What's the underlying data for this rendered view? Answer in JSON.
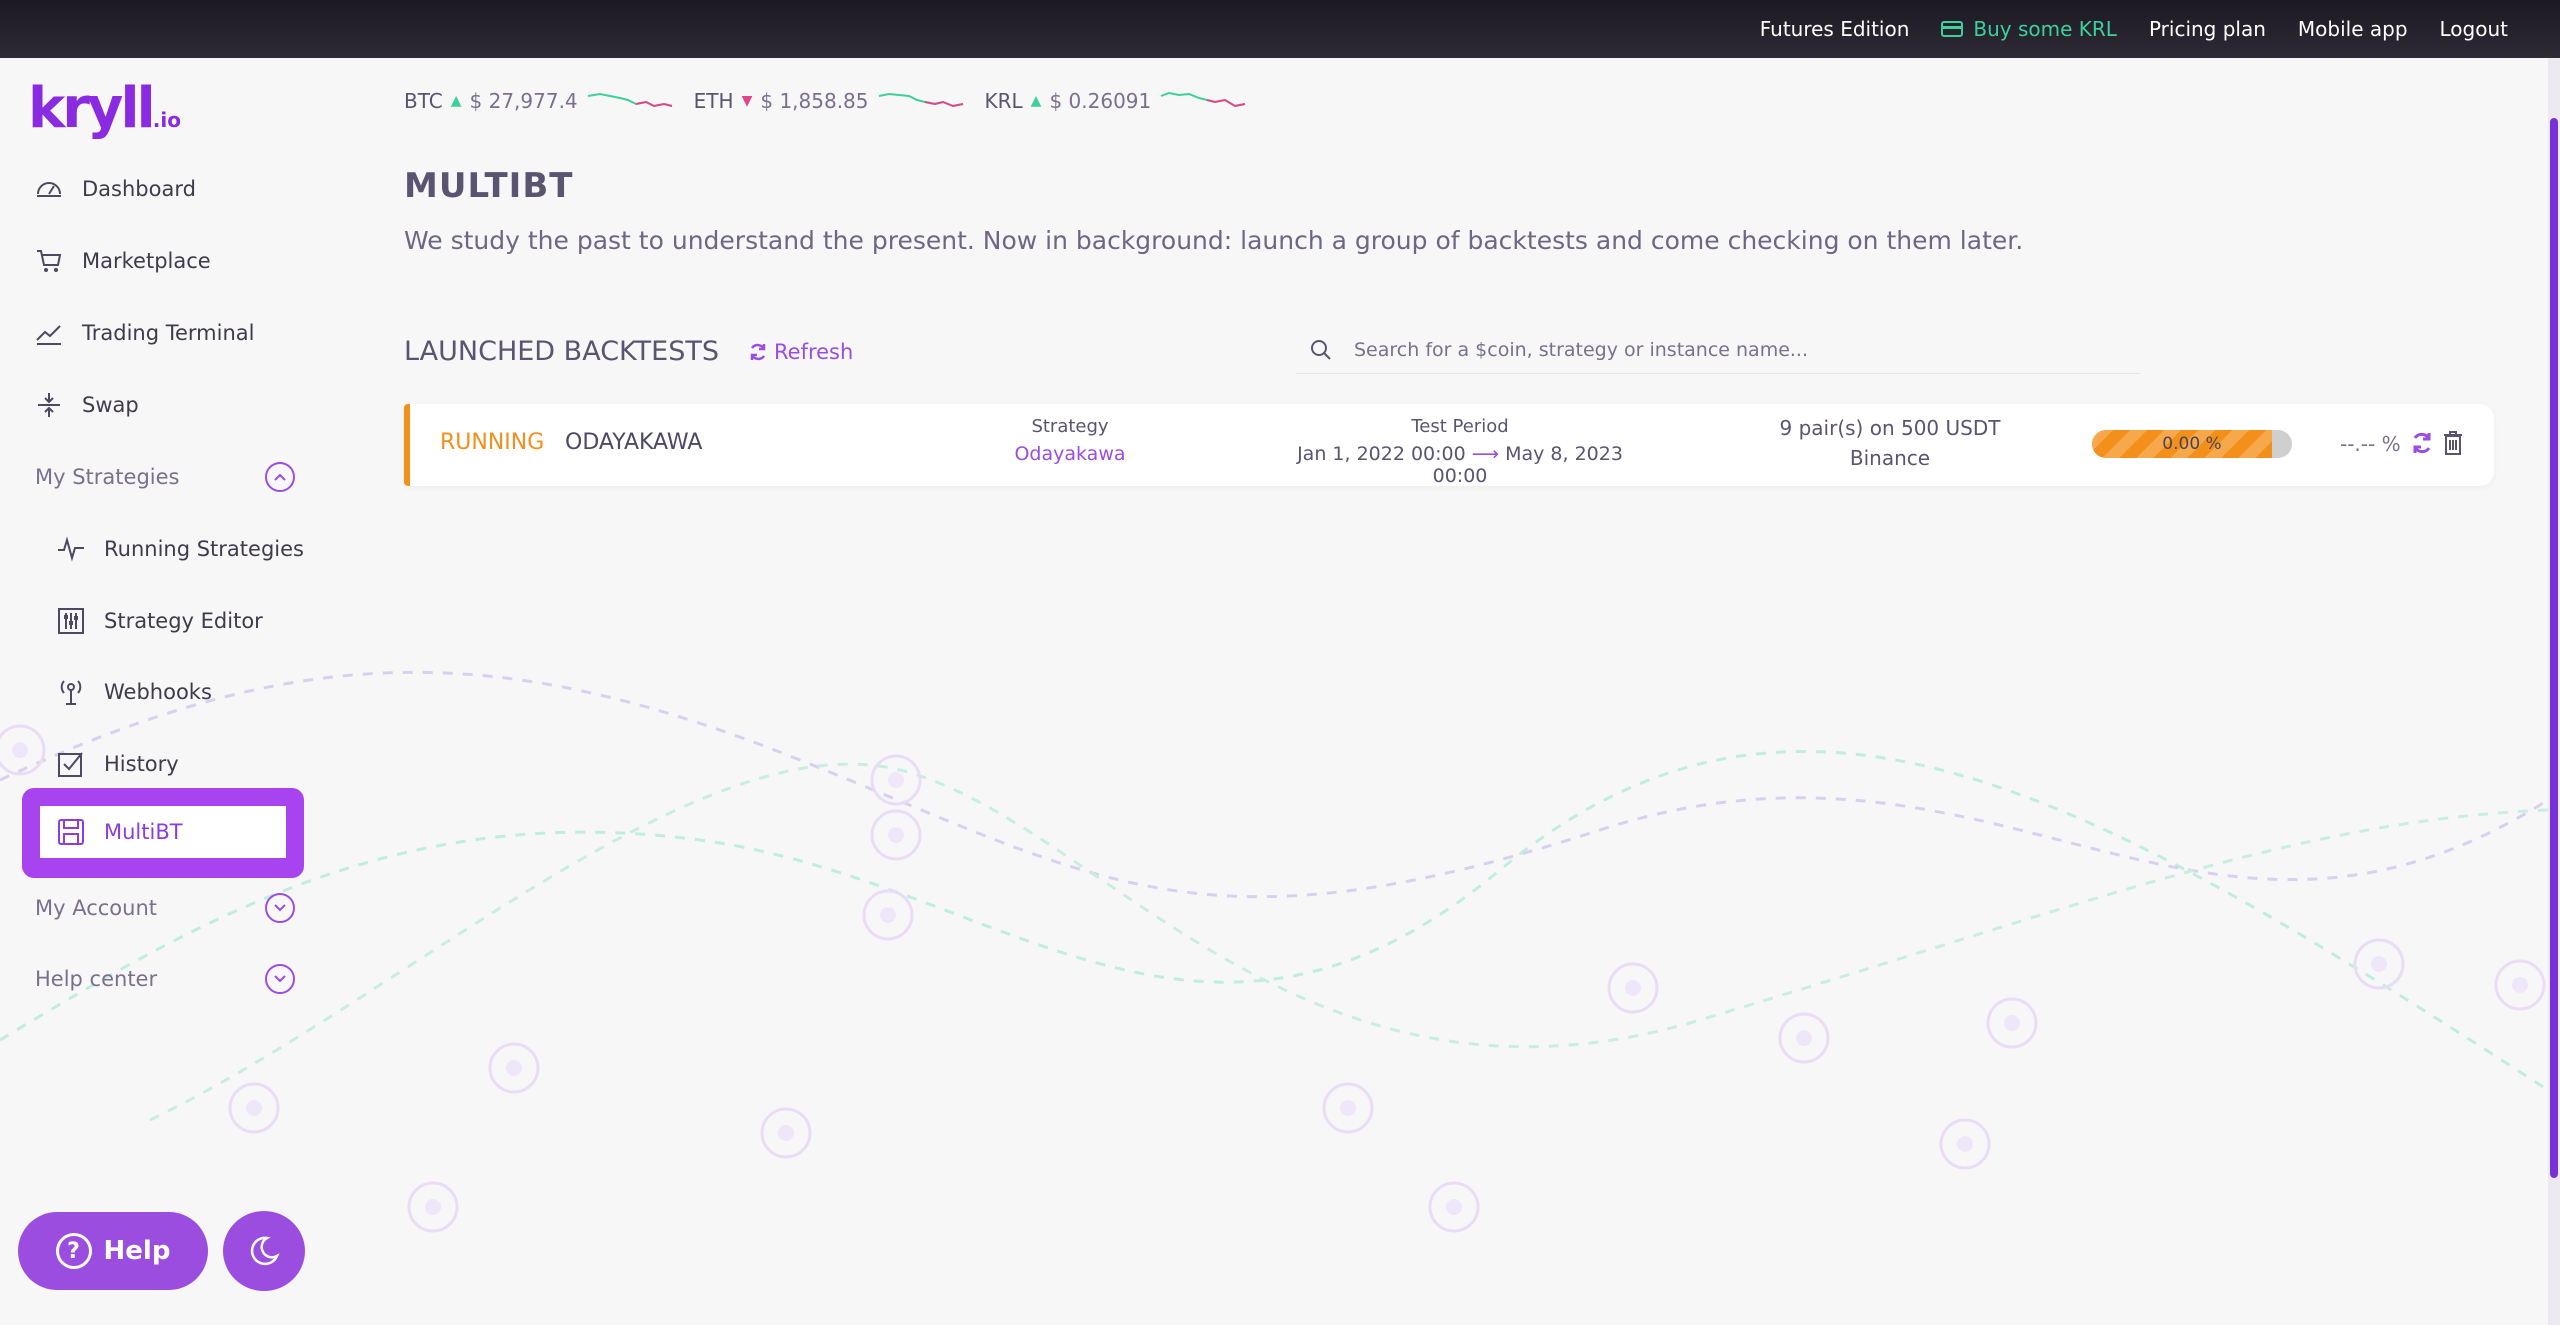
{
  "topbar": {
    "futures": "Futures Edition",
    "buy_krl": "Buy some KRL",
    "pricing": "Pricing plan",
    "mobile": "Mobile app",
    "logout": "Logout"
  },
  "logo": {
    "text": "kryll",
    "suffix": ".io"
  },
  "sidebar": {
    "dashboard": "Dashboard",
    "marketplace": "Marketplace",
    "trading_terminal": "Trading Terminal",
    "swap": "Swap",
    "my_strategies": "My Strategies",
    "running_strategies": "Running Strategies",
    "strategy_editor": "Strategy Editor",
    "webhooks": "Webhooks",
    "history": "History",
    "multibt": "MultiBT",
    "my_account": "My Account",
    "help_center": "Help center"
  },
  "help_button": "Help",
  "ticker": [
    {
      "symbol": "BTC",
      "direction": "up",
      "price": "$ 27,977.4"
    },
    {
      "symbol": "ETH",
      "direction": "down",
      "price": "$ 1,858.85"
    },
    {
      "symbol": "KRL",
      "direction": "up",
      "price": "$ 0.26091"
    }
  ],
  "page": {
    "title": "MULTIBT",
    "description": "We study the past to understand the present. Now in background: launch a group of backtests and come checking on them later."
  },
  "backtests": {
    "section_title": "LAUNCHED BACKTESTS",
    "refresh": "Refresh",
    "search_placeholder": "Search for a $coin, strategy or instance name...",
    "rows": [
      {
        "status": "RUNNING",
        "name": "ODAYAKAWA",
        "strategy_label": "Strategy",
        "strategy": "Odayakawa",
        "period_label": "Test Period",
        "period_start": "Jan 1, 2022 00:00",
        "period_end": "May 8, 2023 00:00",
        "pairs": "9 pair(s) on 500 USDT",
        "exchange": "Binance",
        "progress_text": "0.00 %",
        "progress_fill": 0.9,
        "result": "--.-- %"
      }
    ]
  },
  "colors": {
    "accent": "#9b4de0",
    "running": "#f3901b",
    "up": "#3ed09b",
    "down": "#e0478a"
  }
}
